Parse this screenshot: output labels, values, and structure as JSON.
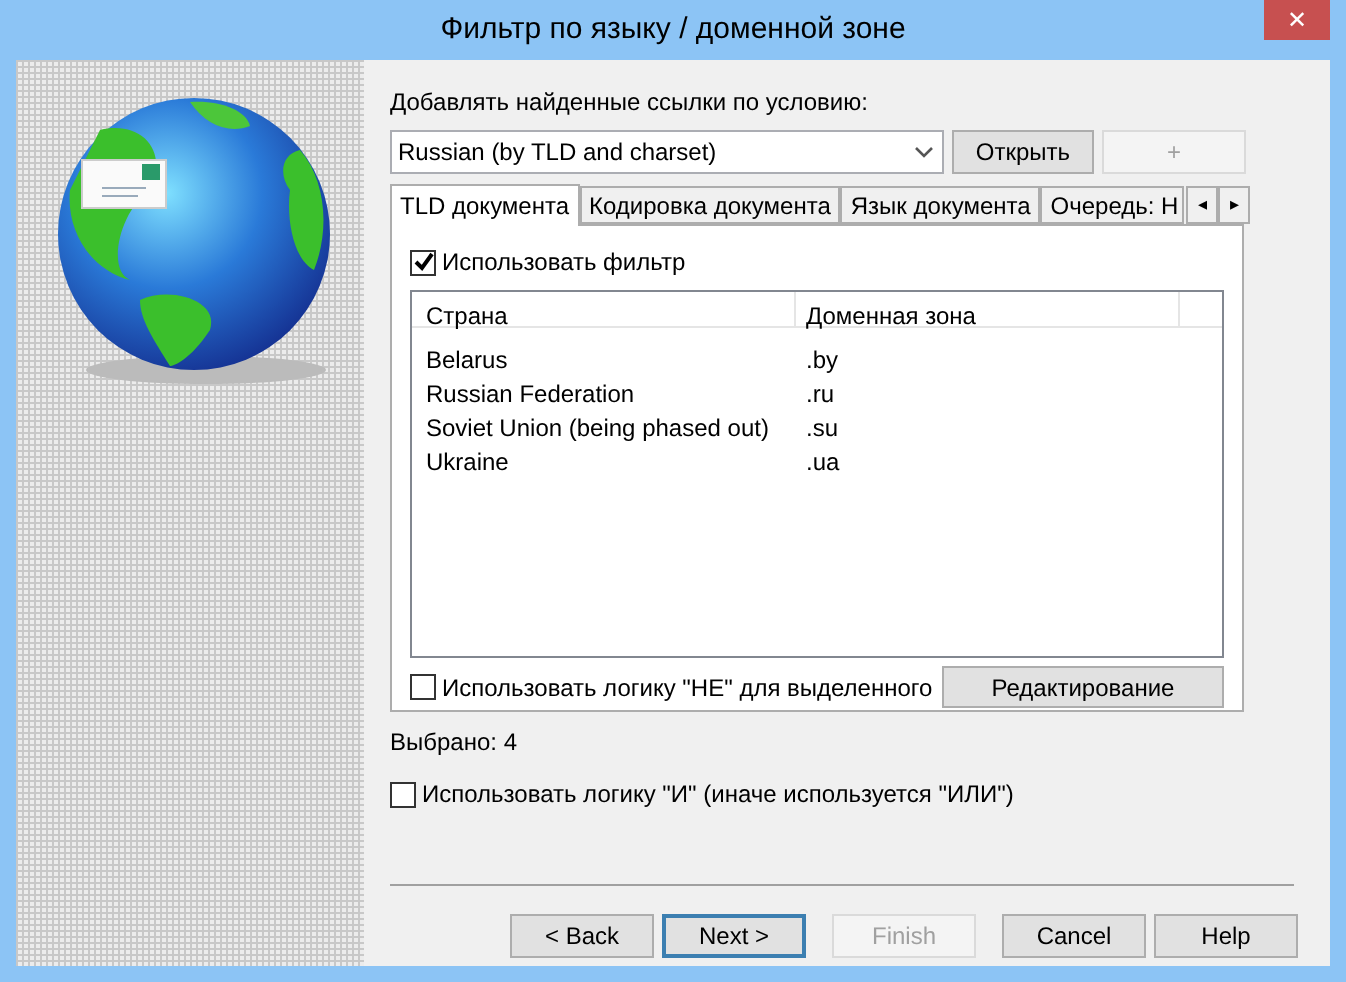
{
  "window": {
    "title": "Фильтр по языку / доменной зоне",
    "close": "✕"
  },
  "condition_label": "Добавлять найденные ссылки по условию:",
  "combo": {
    "value": "Russian (by TLD and charset)"
  },
  "top_buttons": [
    {
      "label": "Открыть",
      "disabled": false
    },
    {
      "label": "+",
      "disabled": true
    }
  ],
  "tabs": [
    {
      "label": "TLD документа",
      "selected": true
    },
    {
      "label": "Кодировка документа",
      "selected": false
    },
    {
      "label": "Язык документа",
      "selected": false
    },
    {
      "label": "Очередь: Н",
      "selected": false
    }
  ],
  "tab_scroll": [
    "◂",
    "▸"
  ],
  "use_filter": {
    "label": "Использовать фильтр",
    "checked": true
  },
  "table": {
    "columns": [
      "Страна",
      "Доменная зона"
    ],
    "rows": [
      [
        "Belarus",
        ".by"
      ],
      [
        "Russian Federation",
        ".ru"
      ],
      [
        "Soviet Union (being phased out)",
        ".su"
      ],
      [
        "Ukraine",
        ".ua"
      ]
    ]
  },
  "not_logic": {
    "label": "Использовать логику \"НЕ\" для выделенного",
    "checked": false
  },
  "edit_button": "Редактирование",
  "selected_count": "Выбрано: 4",
  "and_logic": {
    "label": "Использовать логику \"И\" (иначе используется \"ИЛИ\")",
    "checked": false
  },
  "footer_buttons": [
    {
      "label": "< Back",
      "disabled": false,
      "default": false
    },
    {
      "label": "Next >",
      "disabled": false,
      "default": true
    },
    {
      "label": "Finish",
      "disabled": true,
      "default": false
    },
    {
      "label": "Cancel",
      "disabled": false,
      "default": false
    },
    {
      "label": "Help",
      "disabled": false,
      "default": false
    }
  ]
}
